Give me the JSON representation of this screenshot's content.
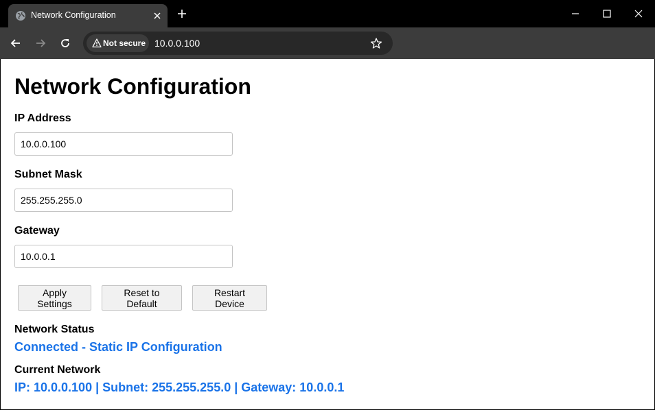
{
  "browser": {
    "tab_title": "Network Configuration",
    "security_label": "Not secure",
    "url": "10.0.0.100"
  },
  "page": {
    "title": "Network Configuration",
    "fields": {
      "ip": {
        "label": "IP Address",
        "value": "10.0.0.100"
      },
      "subnet": {
        "label": "Subnet Mask",
        "value": "255.255.255.0"
      },
      "gateway": {
        "label": "Gateway",
        "value": "10.0.0.1"
      }
    },
    "buttons": {
      "apply": "Apply Settings",
      "reset": "Reset to Default",
      "restart": "Restart Device"
    },
    "network_status": {
      "heading": "Network Status",
      "value": "Connected - Static IP Configuration"
    },
    "current_network": {
      "heading": "Current Network",
      "value": "IP: 10.0.0.100 | Subnet: 255.255.255.0 | Gateway: 10.0.0.1"
    }
  },
  "colors": {
    "status_blue": "#1a73e8",
    "chrome_dark": "#3c3c3c"
  },
  "icons": [
    "globe-icon",
    "close-icon",
    "plus-icon",
    "minimize-icon",
    "maximize-icon",
    "back-icon",
    "forward-icon",
    "reload-icon",
    "warning-icon",
    "star-icon"
  ]
}
